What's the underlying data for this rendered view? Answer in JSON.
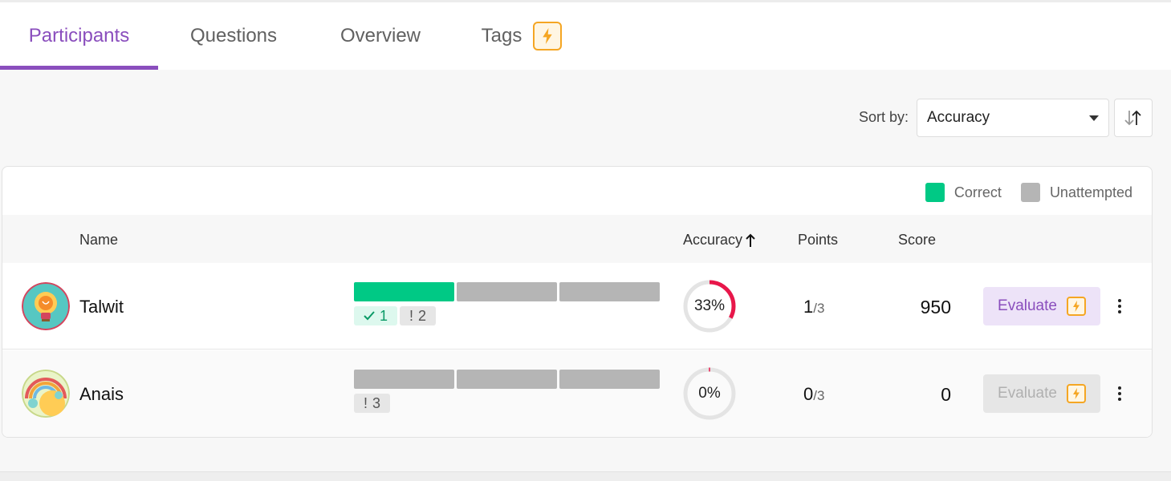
{
  "tabs": [
    {
      "label": "Participants",
      "active": true
    },
    {
      "label": "Questions",
      "active": false
    },
    {
      "label": "Overview",
      "active": false
    },
    {
      "label": "Tags",
      "active": false,
      "icon": "bolt-icon"
    }
  ],
  "sort": {
    "label": "Sort by:",
    "value": "Accuracy",
    "direction_icon": "sort-direction-icon"
  },
  "legend": [
    {
      "label": "Correct",
      "color": "#00c985"
    },
    {
      "label": "Unattempted",
      "color": "#b5b5b5"
    }
  ],
  "table": {
    "headers": {
      "name": "Name",
      "accuracy": "Accuracy",
      "points": "Points",
      "score": "Score"
    },
    "rows": [
      {
        "name": "Talwit",
        "avatar_icon": "lightbulb-avatar-icon",
        "segments": [
          "correct",
          "unattempted",
          "unattempted"
        ],
        "correct_count": "1",
        "unattempted_count": "2",
        "accuracy": "33%",
        "accuracy_value": 0.33,
        "points": "1",
        "points_total": "/3",
        "score": "950",
        "evaluate_label": "Evaluate",
        "evaluate_enabled": true
      },
      {
        "name": "Anais",
        "avatar_icon": "rainbow-avatar-icon",
        "segments": [
          "unattempted",
          "unattempted",
          "unattempted"
        ],
        "correct_count": "",
        "unattempted_count": "3",
        "accuracy": "0%",
        "accuracy_value": 0,
        "points": "0",
        "points_total": "/3",
        "score": "0",
        "evaluate_label": "Evaluate",
        "evaluate_enabled": false
      }
    ]
  },
  "colors": {
    "accent": "#8a4ebd",
    "correct": "#00c985",
    "unattempted": "#b5b5b5",
    "ring_progress": "#e8174a",
    "bolt": "#f5a623"
  }
}
